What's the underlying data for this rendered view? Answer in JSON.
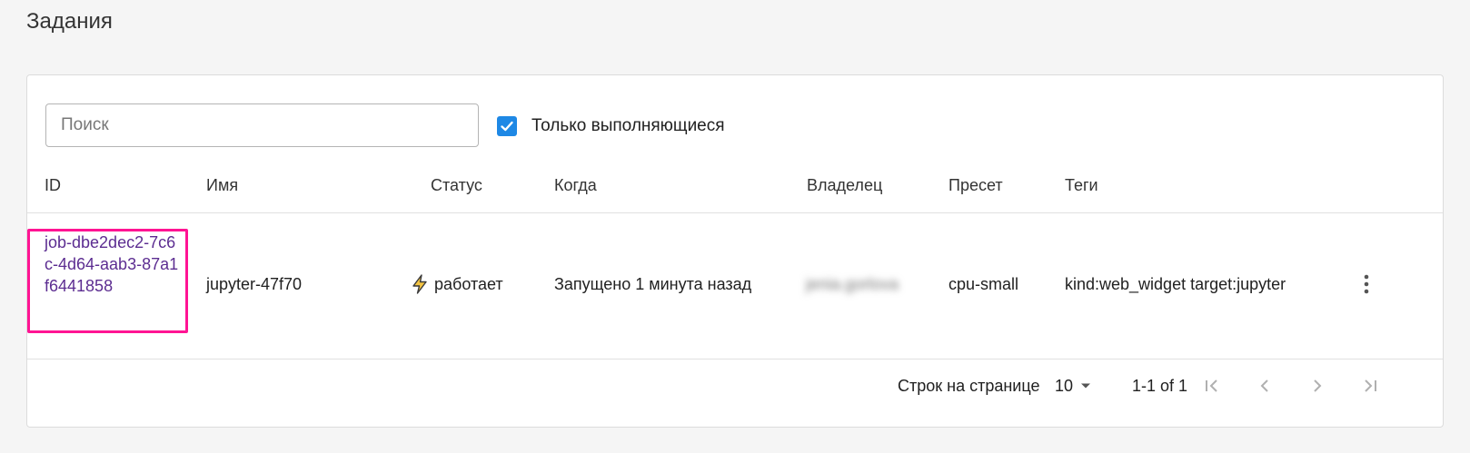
{
  "page": {
    "title": "Задания"
  },
  "search": {
    "placeholder": "Поиск",
    "value": ""
  },
  "filter": {
    "label": "Только выполняющиеся",
    "checked": true
  },
  "table": {
    "columns": [
      "ID",
      "Имя",
      "Статус",
      "Когда",
      "Владелец",
      "Пресет",
      "Теги"
    ],
    "rows": [
      {
        "id": "job-dbe2dec2-7c6c-4d64-aab3-87a1f6441858",
        "name": "jupyter-47f70",
        "status": "работает",
        "status_icon": "lightning-icon",
        "when": "Запущено 1 минута назад",
        "owner": "jenia.gorlova",
        "preset": "cpu-small",
        "tags": "kind:web_widget target:jupyter"
      }
    ]
  },
  "pagination": {
    "rows_per_page_label": "Строк на странице",
    "rows_per_page_value": "10",
    "range_text": "1-1 of 1"
  },
  "colors": {
    "accent": "#1e88e5",
    "link": "#5c2d91",
    "highlight": "#ff1493",
    "status_icon": "#f5a623"
  }
}
